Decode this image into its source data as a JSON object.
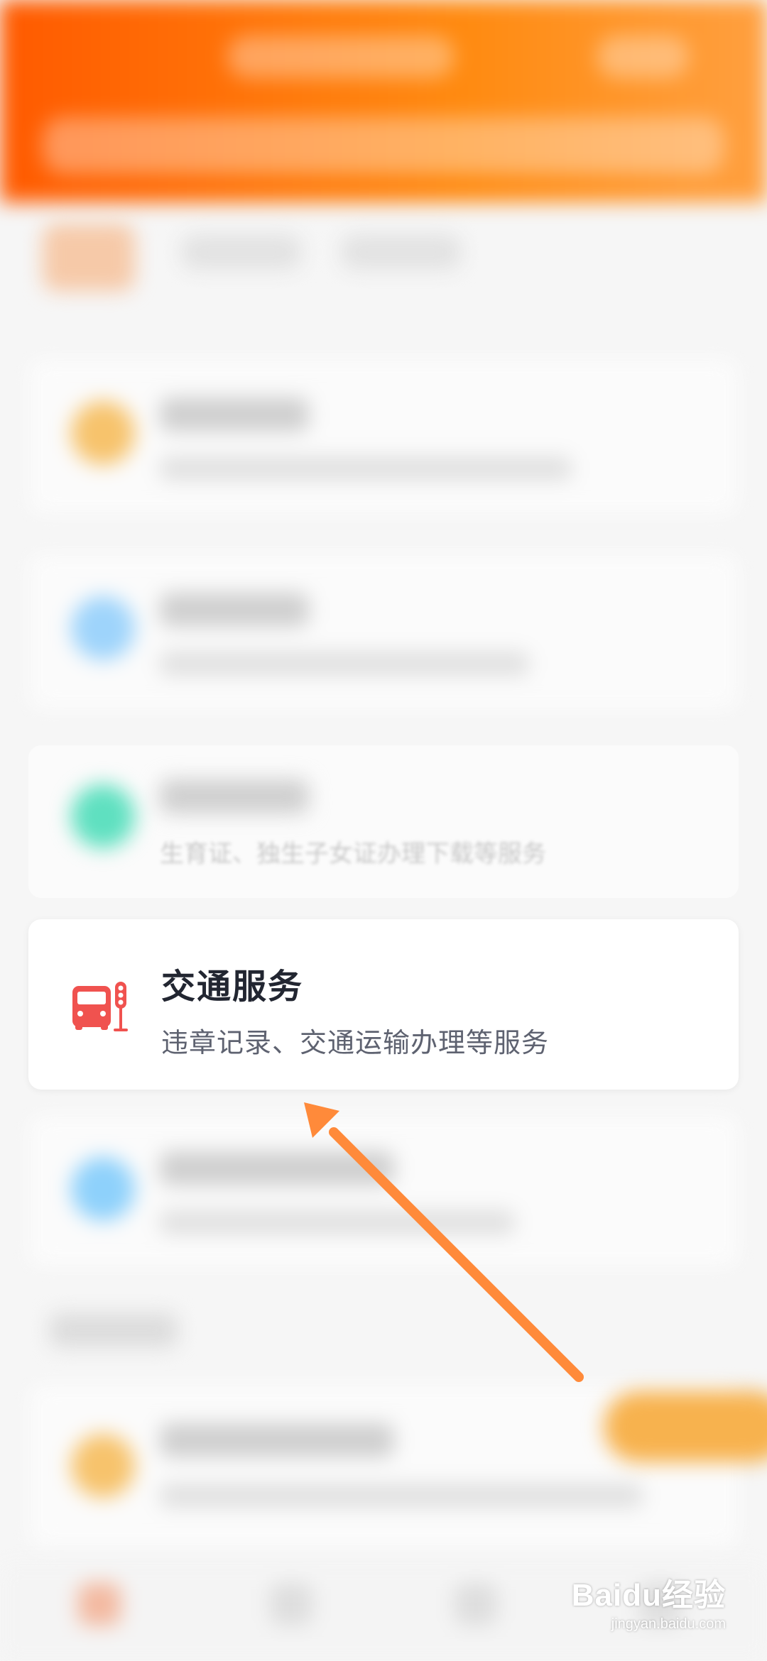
{
  "traffic_service": {
    "title": "交通服务",
    "description": "违章记录、交通运输办理等服务",
    "icon": "bus-traffic-light-icon",
    "icon_color": "#f0524f"
  },
  "family_service": {
    "description": "生育证、独生子女证办理下载等服务"
  },
  "watermark": {
    "brand": "Baidu经验",
    "url": "jingyan.baidu.com"
  },
  "colors": {
    "header_start": "#ff5a00",
    "header_end": "#ffa040",
    "arrow": "#ff8a3a"
  }
}
